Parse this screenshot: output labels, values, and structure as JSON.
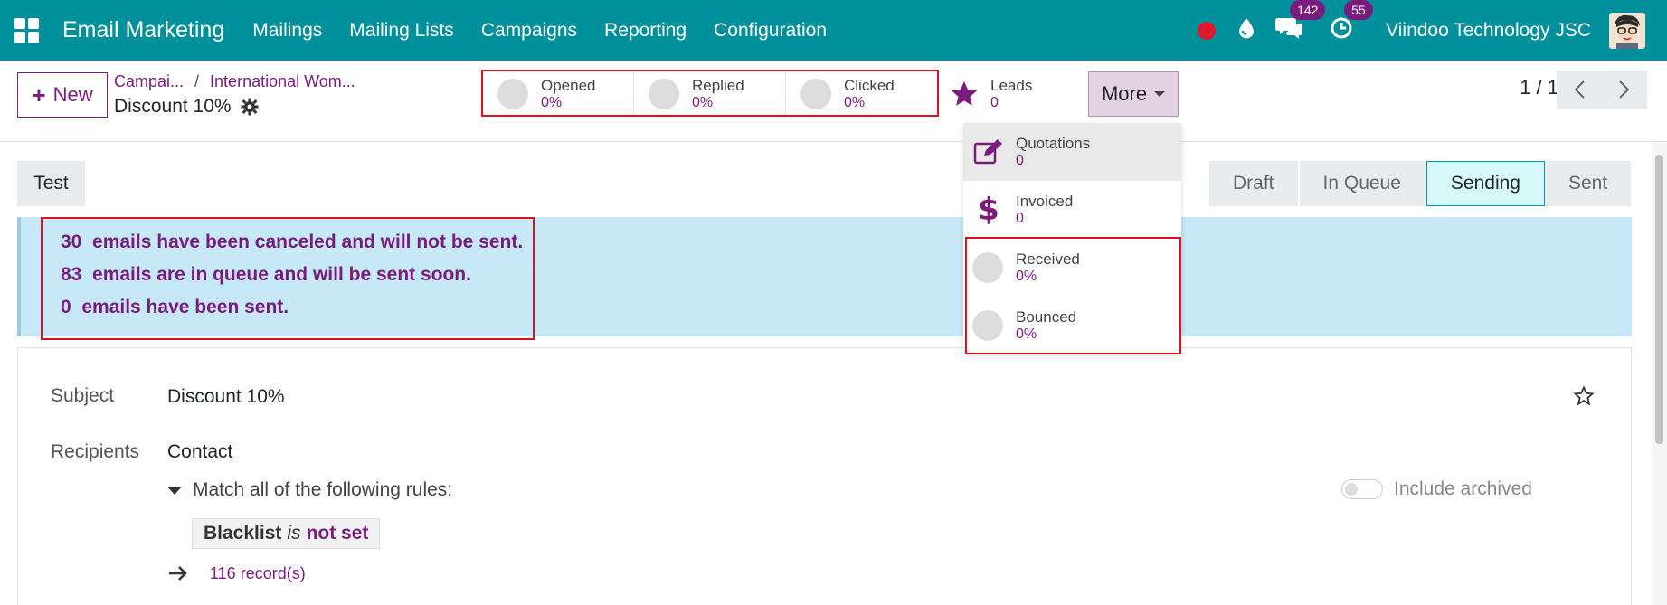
{
  "navbar": {
    "app_name": "Email Marketing",
    "menu": [
      "Mailings",
      "Mailing Lists",
      "Campaigns",
      "Reporting",
      "Configuration"
    ],
    "messages_count": "142",
    "activities_count": "55",
    "company": "Viindoo Technology JSC"
  },
  "control": {
    "new_label": "New",
    "breadcrumb": [
      "Campai...",
      "International Wom..."
    ],
    "record_title": "Discount 10%",
    "stats": [
      {
        "label": "Opened",
        "value": "0%"
      },
      {
        "label": "Replied",
        "value": "0%"
      },
      {
        "label": "Clicked",
        "value": "0%"
      },
      {
        "label": "Leads",
        "value": "0"
      }
    ],
    "more_label": "More",
    "pager": "1 / 1"
  },
  "more_menu": [
    {
      "label": "Quotations",
      "value": "0",
      "icon": "edit-icon"
    },
    {
      "label": "Invoiced",
      "value": "0",
      "icon": "dollar-icon"
    },
    {
      "label": "Received",
      "value": "0%",
      "icon": "circle"
    },
    {
      "label": "Bounced",
      "value": "0%",
      "icon": "circle"
    }
  ],
  "content": {
    "test_label": "Test",
    "stages": [
      "Draft",
      "In Queue",
      "Sending",
      "Sent"
    ],
    "active_stage": "Sending",
    "alert_lines": [
      "30  emails have been canceled and will not be sent.",
      "83  emails are in queue and will be sent soon.",
      "0  emails have been sent."
    ],
    "subject_label": "Subject",
    "subject_value": "Discount 10%",
    "recipients_label": "Recipients",
    "recipients_value": "Contact",
    "match_rules": "Match all of the following rules:",
    "include_archived": "Include archived",
    "rule_field": "Blacklist",
    "rule_operator": "is",
    "rule_value": "not set",
    "records": "116 record(s)"
  },
  "colors": {
    "navbar": "#00909b",
    "accent": "#7a1b7e",
    "alert_bg": "#c6e8f7",
    "annotation": "#e0101e"
  }
}
